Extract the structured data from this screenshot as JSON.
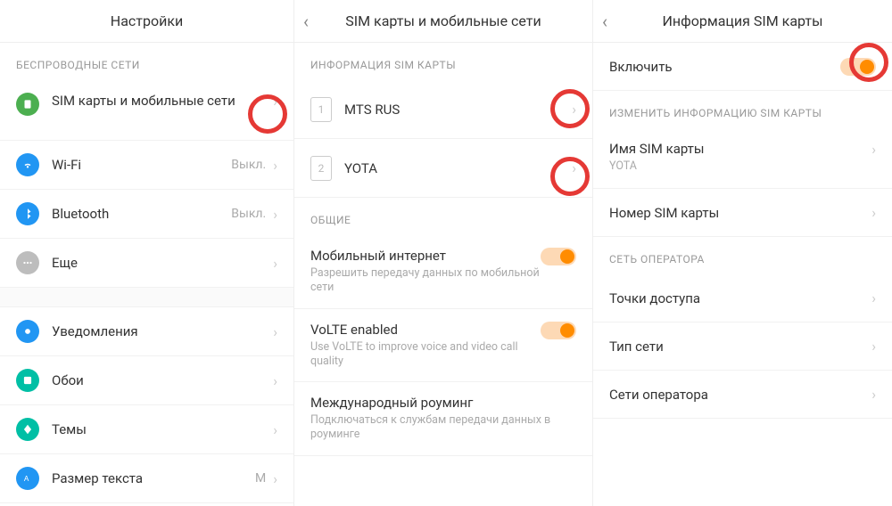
{
  "pane1": {
    "title": "Настройки",
    "section_wireless": "БЕСПРОВОДНЫЕ СЕТИ",
    "items": {
      "sim": "SIM карты и мобильные сети",
      "wifi": "Wi-Fi",
      "wifi_val": "Выкл.",
      "bt": "Bluetooth",
      "bt_val": "Выкл.",
      "more": "Еще",
      "notif": "Уведомления",
      "wall": "Обои",
      "themes": "Темы",
      "text_size": "Размер текста",
      "text_size_val": "М"
    }
  },
  "pane2": {
    "title": "SIM карты и мобильные сети",
    "section_sim_info": "ИНФОРМАЦИЯ SIM КАРТЫ",
    "sim1": {
      "num": "1",
      "label": "MTS RUS"
    },
    "sim2": {
      "num": "2",
      "label": "YOTA"
    },
    "section_general": "ОБЩИЕ",
    "mobile_data": {
      "title": "Мобильный интернет",
      "sub": "Разрешить передачу данных по мобильной сети"
    },
    "volte": {
      "title": "VoLTE enabled",
      "sub": "Use VoLTE to improve voice and video call quality"
    },
    "roaming": {
      "title": "Международный роуминг",
      "sub": "Подключаться к службам передачи данных в роуминге"
    }
  },
  "pane3": {
    "title": "Информация SIM карты",
    "enable": "Включить",
    "section_edit": "ИЗМЕНИТЬ ИНФОРМАЦИЮ SIM КАРТЫ",
    "sim_name": {
      "title": "Имя SIM карты",
      "sub": "YOTA"
    },
    "sim_number": "Номер SIM карты",
    "section_network": "СЕТЬ ОПЕРАТОРА",
    "apn": "Точки доступа",
    "net_type": "Тип сети",
    "operators": "Сети оператора"
  }
}
